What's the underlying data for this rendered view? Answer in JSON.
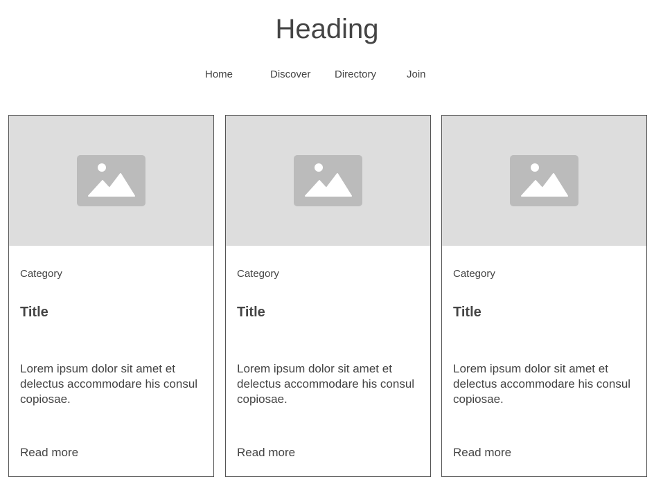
{
  "header": {
    "heading": "Heading"
  },
  "nav": {
    "items": [
      {
        "label": "Home"
      },
      {
        "label": "Discover"
      },
      {
        "label": "Directory"
      },
      {
        "label": "Join"
      }
    ]
  },
  "cards": [
    {
      "image_icon": "image-placeholder-icon",
      "category": "Category",
      "title": "Title",
      "body": "Lorem ipsum dolor sit amet et delectus accommodare his consul copiosae.",
      "link": "Read more"
    },
    {
      "image_icon": "image-placeholder-icon",
      "category": "Category",
      "title": "Title",
      "body": "Lorem ipsum dolor sit amet et delectus accommodare his consul copiosae.",
      "link": "Read more"
    },
    {
      "image_icon": "image-placeholder-icon",
      "category": "Category",
      "title": "Title",
      "body": "Lorem ipsum dolor sit amet et delectus accommodare his consul copiosae.",
      "link": "Read more"
    }
  ],
  "colors": {
    "text": "#444444",
    "image_bg": "#dddddd",
    "icon": "#bbbbbb",
    "border": "#555555"
  }
}
